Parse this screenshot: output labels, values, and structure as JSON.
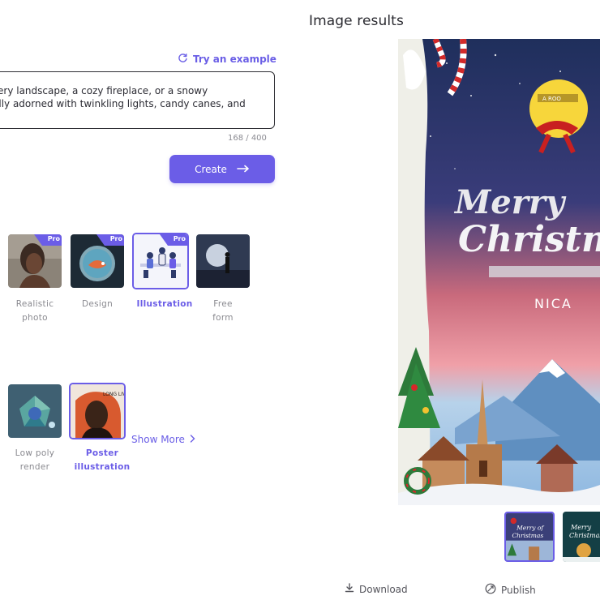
{
  "header": {
    "title": "Image results"
  },
  "prompt": {
    "try_example_label": "Try an example",
    "line1": "ery landscape, a cozy fireplace, or a snowy",
    "line2": "ally adorned with twinkling lights, candy canes, and",
    "counter": "168 / 400",
    "create_label": "Create"
  },
  "styles": {
    "pro_label": "Pro",
    "row1": [
      {
        "label": "Realistic photo",
        "pro": true,
        "selected": false
      },
      {
        "label": "Design",
        "pro": true,
        "selected": false
      },
      {
        "label": "Illustration",
        "pro": true,
        "selected": true
      },
      {
        "label": "Free form",
        "pro": false,
        "selected": false
      }
    ],
    "row2": [
      {
        "label": "Low poly render",
        "pro": false,
        "selected": false
      },
      {
        "label": "Poster illustration",
        "pro": false,
        "selected": true
      }
    ],
    "labels_split": {
      "realistic": [
        "Realistic",
        "photo"
      ],
      "free": [
        "Free",
        "form"
      ],
      "lowpoly": [
        "Low poly",
        "render"
      ],
      "poster": [
        "Poster",
        "illustration"
      ]
    },
    "show_more_label": "Show More"
  },
  "result_image": {
    "title_line1": "Merry",
    "title_line2": "Christm",
    "subtitle": "NICA",
    "sign_text": "A ROO"
  },
  "thumbnails": [
    {
      "label_line1": "Merry of",
      "label_line2": "Christmas",
      "selected": true
    },
    {
      "label_line1": "Merry",
      "label_line2": "Christmas",
      "selected": false
    }
  ],
  "actions": {
    "download_label": "Download",
    "publish_label": "Publish"
  },
  "colors": {
    "accent": "#6b5de7",
    "text": "#2b2b33",
    "muted": "#8a8a90"
  }
}
